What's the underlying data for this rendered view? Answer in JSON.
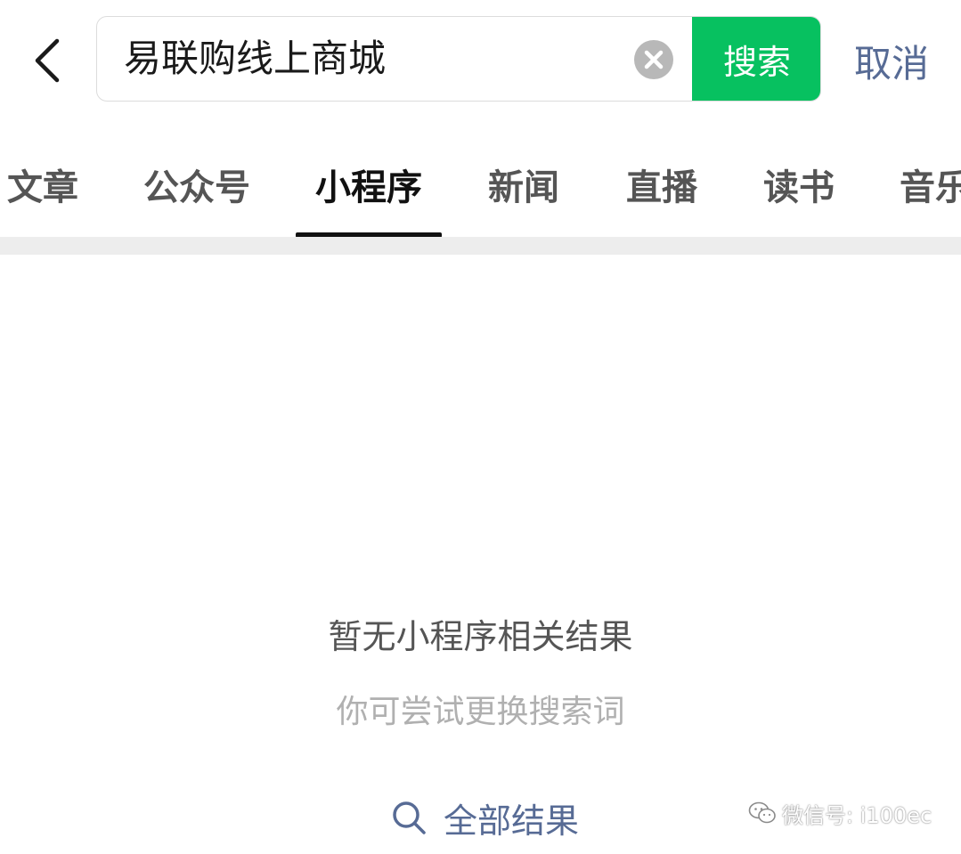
{
  "search": {
    "query": "易联购线上商城",
    "search_label": "搜索",
    "cancel_label": "取消"
  },
  "tabs": [
    {
      "label": "文章"
    },
    {
      "label": "公众号"
    },
    {
      "label": "小程序",
      "active": true
    },
    {
      "label": "新闻"
    },
    {
      "label": "直播"
    },
    {
      "label": "读书"
    },
    {
      "label": "音乐"
    }
  ],
  "empty_state": {
    "title": "暂无小程序相关结果",
    "hint": "你可尝试更换搜索词",
    "all_results_label": "全部结果"
  },
  "watermark": {
    "text": "微信号: i100ec"
  },
  "colors": {
    "accent_green": "#07c160",
    "link_blue": "#576b95",
    "active_tab": "#111111"
  }
}
